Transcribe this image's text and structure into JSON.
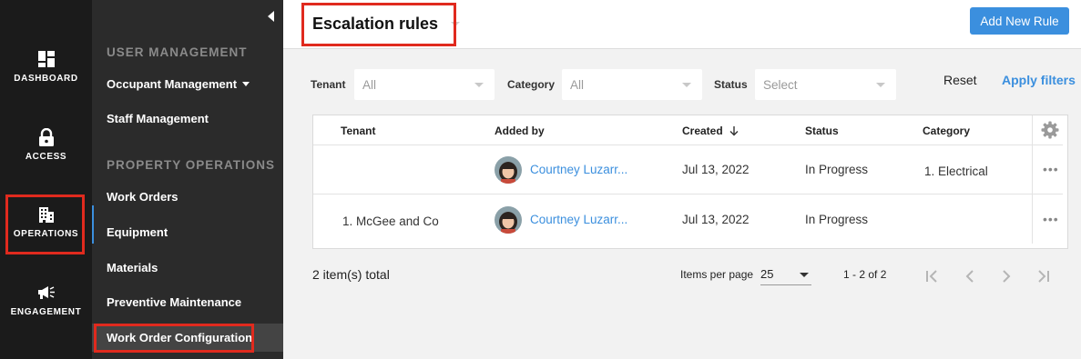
{
  "rail": {
    "items": [
      {
        "label": "DASHBOARD",
        "icon": "dashboard-icon"
      },
      {
        "label": "ACCESS",
        "icon": "lock-icon"
      },
      {
        "label": "OPERATIONS",
        "icon": "building-icon"
      },
      {
        "label": "ENGAGEMENT",
        "icon": "megaphone-icon"
      }
    ]
  },
  "subnav": {
    "sections": [
      {
        "title": "USER MANAGEMENT",
        "items": [
          {
            "label": "Occupant Management"
          },
          {
            "label": "Staff Management"
          }
        ]
      },
      {
        "title": "PROPERTY OPERATIONS",
        "items": [
          {
            "label": "Work Orders"
          },
          {
            "label": "Equipment"
          },
          {
            "label": "Materials"
          },
          {
            "label": "Preventive Maintenance"
          },
          {
            "label": "Work Order Configuration"
          }
        ]
      }
    ]
  },
  "header": {
    "title": "Escalation rules",
    "add_button": "Add New Rule"
  },
  "filters": {
    "tenant": {
      "label": "Tenant",
      "value": "All"
    },
    "category": {
      "label": "Category",
      "value": "All"
    },
    "status": {
      "label": "Status",
      "placeholder": "Select"
    },
    "reset": "Reset",
    "apply": "Apply filters"
  },
  "table": {
    "columns": [
      "Tenant",
      "Added by",
      "Created",
      "Status",
      "Category"
    ],
    "rows": [
      {
        "tenant": "",
        "added_by": "Courtney Luzarr...",
        "created": "Jul 13, 2022",
        "status": "In Progress",
        "category": "1. Electrical",
        "more": "•••"
      },
      {
        "tenant": "1. McGee and Co",
        "added_by": "Courtney Luzarr...",
        "created": "Jul 13, 2022",
        "status": "In Progress",
        "category": "",
        "more": "•••"
      }
    ]
  },
  "footer": {
    "total": "2 item(s) total",
    "items_per_page_label": "Items per page",
    "items_per_page": "25",
    "range": "1 - 2 of 2"
  },
  "colors": {
    "accent": "#3b8fde",
    "highlight": "#e02a1e",
    "rail_bg": "#1b1b1b",
    "subnav_bg": "#2b2b2b"
  }
}
